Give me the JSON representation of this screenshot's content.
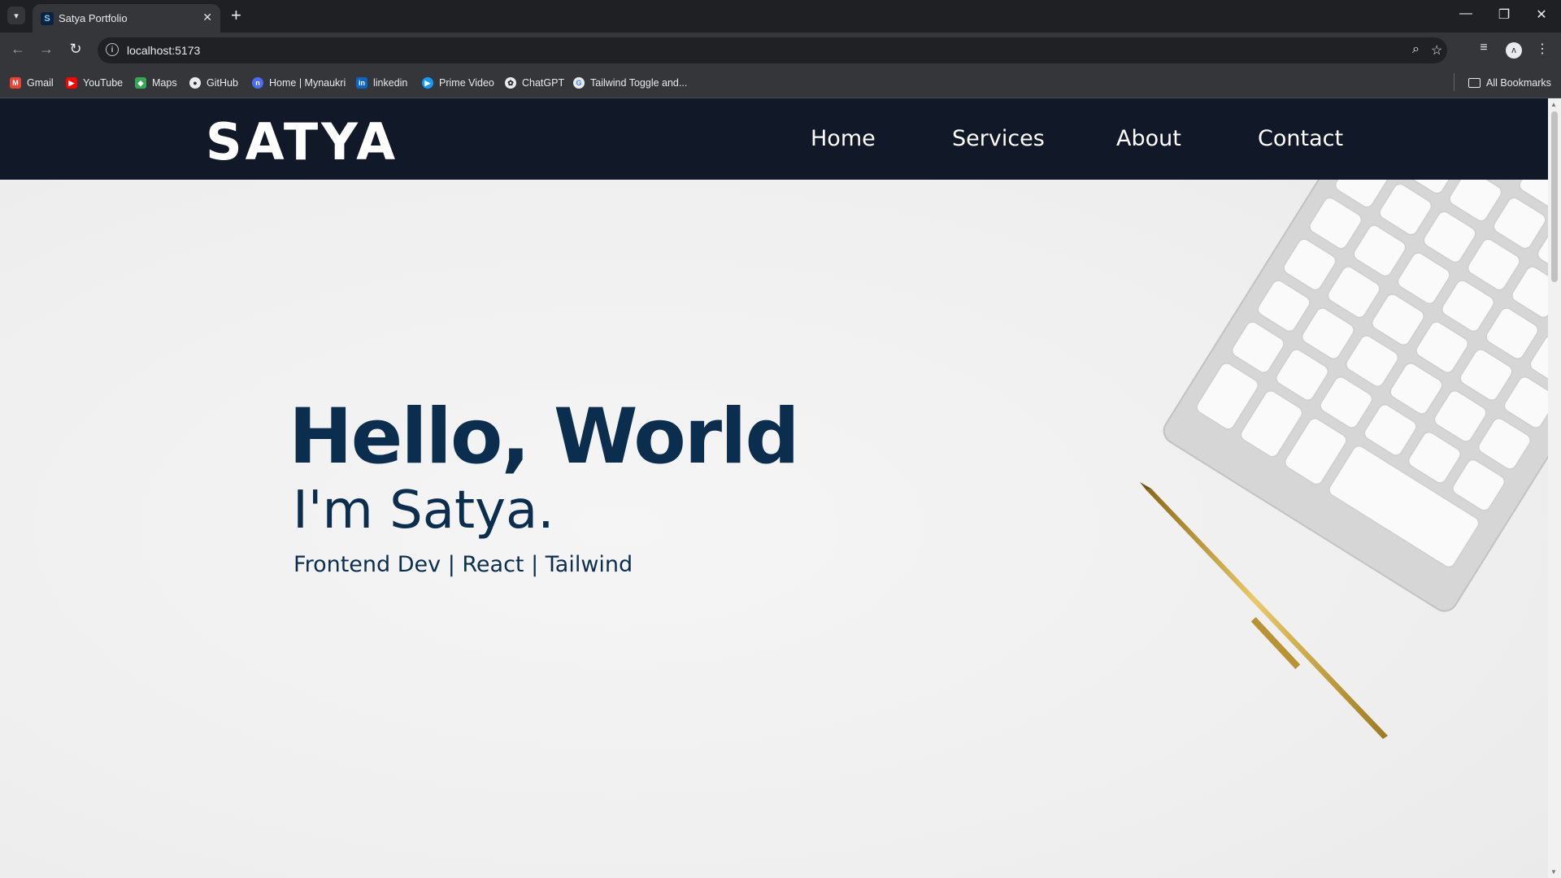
{
  "browser": {
    "tab_title": "Satya Portfolio",
    "url": "localhost:5173",
    "bookmarks": [
      "Gmail",
      "YouTube",
      "Maps",
      "GitHub",
      "Home | Mynaukri",
      "linkedin",
      "Prime Video",
      "ChatGPT",
      "Tailwind Toggle and..."
    ],
    "all_bookmarks": "All Bookmarks"
  },
  "navbar": {
    "logo_text": "SATYA",
    "links": [
      "Home",
      "Services",
      "About",
      "Contact"
    ]
  },
  "hero": {
    "title": "Hello, World",
    "subtitle": "I'm Satya.",
    "tagline": "Frontend Dev | React | Tailwind"
  },
  "colors": {
    "navbar_bg": "#111827",
    "hero_text": "#0b2e4f",
    "page_bg": "#efefef"
  }
}
